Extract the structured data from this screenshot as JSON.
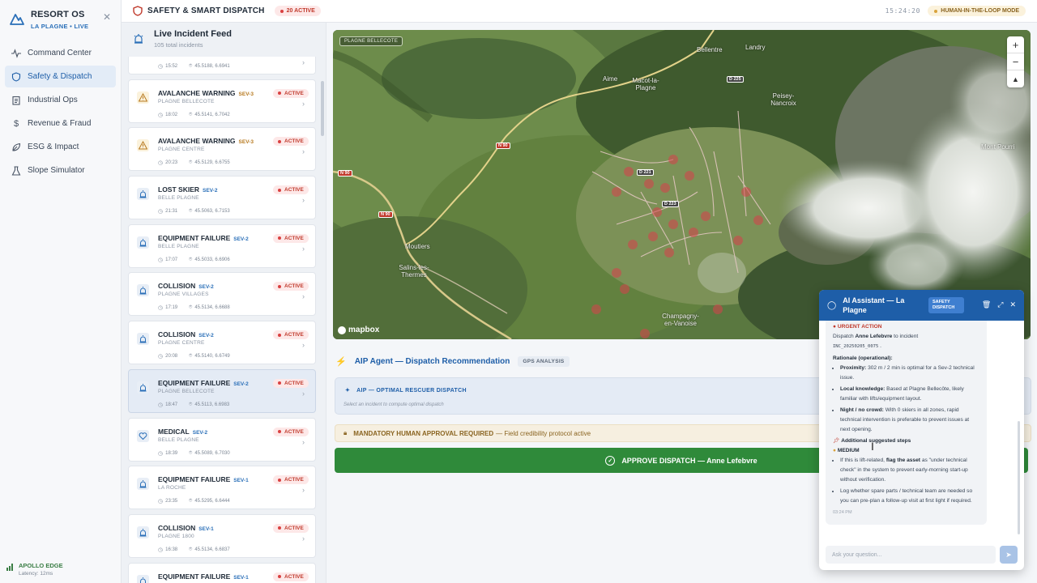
{
  "brand": {
    "title": "RESORT OS",
    "subtitle": "LA PLAGNE • LIVE"
  },
  "nav": [
    {
      "label": "Command Center",
      "icon": "pulse-icon"
    },
    {
      "label": "Safety & Dispatch",
      "icon": "shield-icon",
      "active": true
    },
    {
      "label": "Industrial Ops",
      "icon": "clipboard-icon"
    },
    {
      "label": "Revenue & Fraud",
      "icon": "dollar-icon"
    },
    {
      "label": "ESG & Impact",
      "icon": "leaf-icon"
    },
    {
      "label": "Slope Simulator",
      "icon": "flask-icon"
    }
  ],
  "edge": {
    "title": "APOLLO EDGE",
    "latency": "Latency: 12ms"
  },
  "topbar": {
    "title": "SAFETY & SMART DISPATCH",
    "active_count": "20 ACTIVE",
    "clock": "15:24:20",
    "mode": "HUMAN-IN-THE-LOOP MODE"
  },
  "feed": {
    "title": "Live Incident Feed",
    "count": "105 total incidents",
    "partial": {
      "time": "15:52",
      "coords": "45.5188, 6.6941"
    },
    "items": [
      {
        "title": "AVALANCHE WARNING",
        "sev": "SEV-3",
        "loc": "PLAGNE BELLECOTE",
        "time": "18:02",
        "coords": "45.5141, 6.7042",
        "status": "ACTIVE",
        "icon": "warning-icon"
      },
      {
        "title": "AVALANCHE WARNING",
        "sev": "SEV-3",
        "loc": "PLAGNE CENTRE",
        "time": "20:23",
        "coords": "45.5129, 6.6755",
        "status": "ACTIVE",
        "icon": "warning-icon"
      },
      {
        "title": "LOST SKIER",
        "sev": "SEV-2",
        "loc": "BELLE PLAGNE",
        "time": "21:31",
        "coords": "45.5063, 6.7153",
        "status": "ACTIVE",
        "icon": "siren-icon"
      },
      {
        "title": "EQUIPMENT FAILURE",
        "sev": "SEV-2",
        "loc": "BELLE PLAGNE",
        "time": "17:07",
        "coords": "45.5033, 6.6906",
        "status": "ACTIVE",
        "icon": "siren-icon"
      },
      {
        "title": "COLLISION",
        "sev": "SEV-2",
        "loc": "PLAGNE VILLAGES",
        "time": "17:19",
        "coords": "45.5134, 6.6688",
        "status": "ACTIVE",
        "icon": "siren-icon"
      },
      {
        "title": "COLLISION",
        "sev": "SEV-2",
        "loc": "PLAGNE CENTRE",
        "time": "20:08",
        "coords": "45.5140, 6.6749",
        "status": "ACTIVE",
        "icon": "siren-icon"
      },
      {
        "title": "EQUIPMENT FAILURE",
        "sev": "SEV-2",
        "loc": "PLAGNE BELLECOTE",
        "time": "18:47",
        "coords": "45.5113, 6.6983",
        "status": "ACTIVE",
        "icon": "siren-icon",
        "selected": true
      },
      {
        "title": "MEDICAL",
        "sev": "SEV-2",
        "loc": "BELLE PLAGNE",
        "time": "18:39",
        "coords": "45.5089, 6.7030",
        "status": "ACTIVE",
        "icon": "heart-icon"
      },
      {
        "title": "EQUIPMENT FAILURE",
        "sev": "SEV-1",
        "loc": "LA ROCHE",
        "time": "23:35",
        "coords": "45.5295, 6.6444",
        "status": "ACTIVE",
        "icon": "siren-icon"
      },
      {
        "title": "COLLISION",
        "sev": "SEV-1",
        "loc": "PLAGNE 1800",
        "time": "16:38",
        "coords": "45.5134, 6.6837",
        "status": "ACTIVE",
        "icon": "siren-icon"
      },
      {
        "title": "EQUIPMENT FAILURE",
        "sev": "SEV-1",
        "loc": "",
        "time": "",
        "coords": "",
        "status": "ACTIVE",
        "icon": "siren-icon"
      }
    ]
  },
  "map": {
    "tag": "PLAGNE BELLECOTE",
    "attribution": "mapbox",
    "places": [
      "Bellentre",
      "Landry",
      "Aime",
      "Macot-la-Plagne",
      "Peisey-Nancroix",
      "Mont Pourri",
      "Moutiers",
      "Salins-les-Thermes",
      "Champagny-en-Vanoise"
    ],
    "roads": [
      "N 90",
      "N 90",
      "N 90",
      "D 225",
      "D 221",
      "D 223"
    ]
  },
  "aip": {
    "title": "AIP Agent — Dispatch Recommendation",
    "tag": "GPS ANALYSIS",
    "box_title": "AIP — OPTIMAL RESCUER DISPATCH",
    "box_sub": "Select an incident to compute optimal dispatch",
    "mandatory_bold": "MANDATORY HUMAN APPROVAL REQUIRED",
    "mandatory_rest": "— Field credibility protocol active",
    "approve": "APPROVE DISPATCH — Anne Lefebvre"
  },
  "chat": {
    "title": "AI Assistant — La Plagne",
    "tag": "SAFETY DISPATCH",
    "urgent": "URGENT ACTION",
    "dispatch_pre": "Dispatch",
    "dispatch_name": "Anne Lefebvre",
    "dispatch_post": "to incident",
    "incident_code": "INC_20250205_0075",
    "rationale": "Rationale (operational):",
    "r1_b": "Proximity:",
    "r1": "302 m / 2 min is optimal for a Sev-2 technical issue.",
    "r2_b": "Local knowledge:",
    "r2": "Based at Plagne Bellecôte, likely familiar with lifts/equipment layout.",
    "r3_b": "Night / no crowd:",
    "r3": "With 0 skiers in all zones, rapid technical intervention is preferable to prevent issues at next opening.",
    "steps": "Additional suggested steps",
    "medium": "MEDIUM",
    "s1_a": "If this is lift-related,",
    "s1_b": "flag the asset",
    "s1_c": "as \"under technical check\" in the system to prevent early-morning start-up without verification.",
    "s2": "Log whether spare parts / technical team are needed so you can pre-plan a follow-up visit at first light if required.",
    "time": "03:24 PM",
    "placeholder": "Ask your question..."
  }
}
